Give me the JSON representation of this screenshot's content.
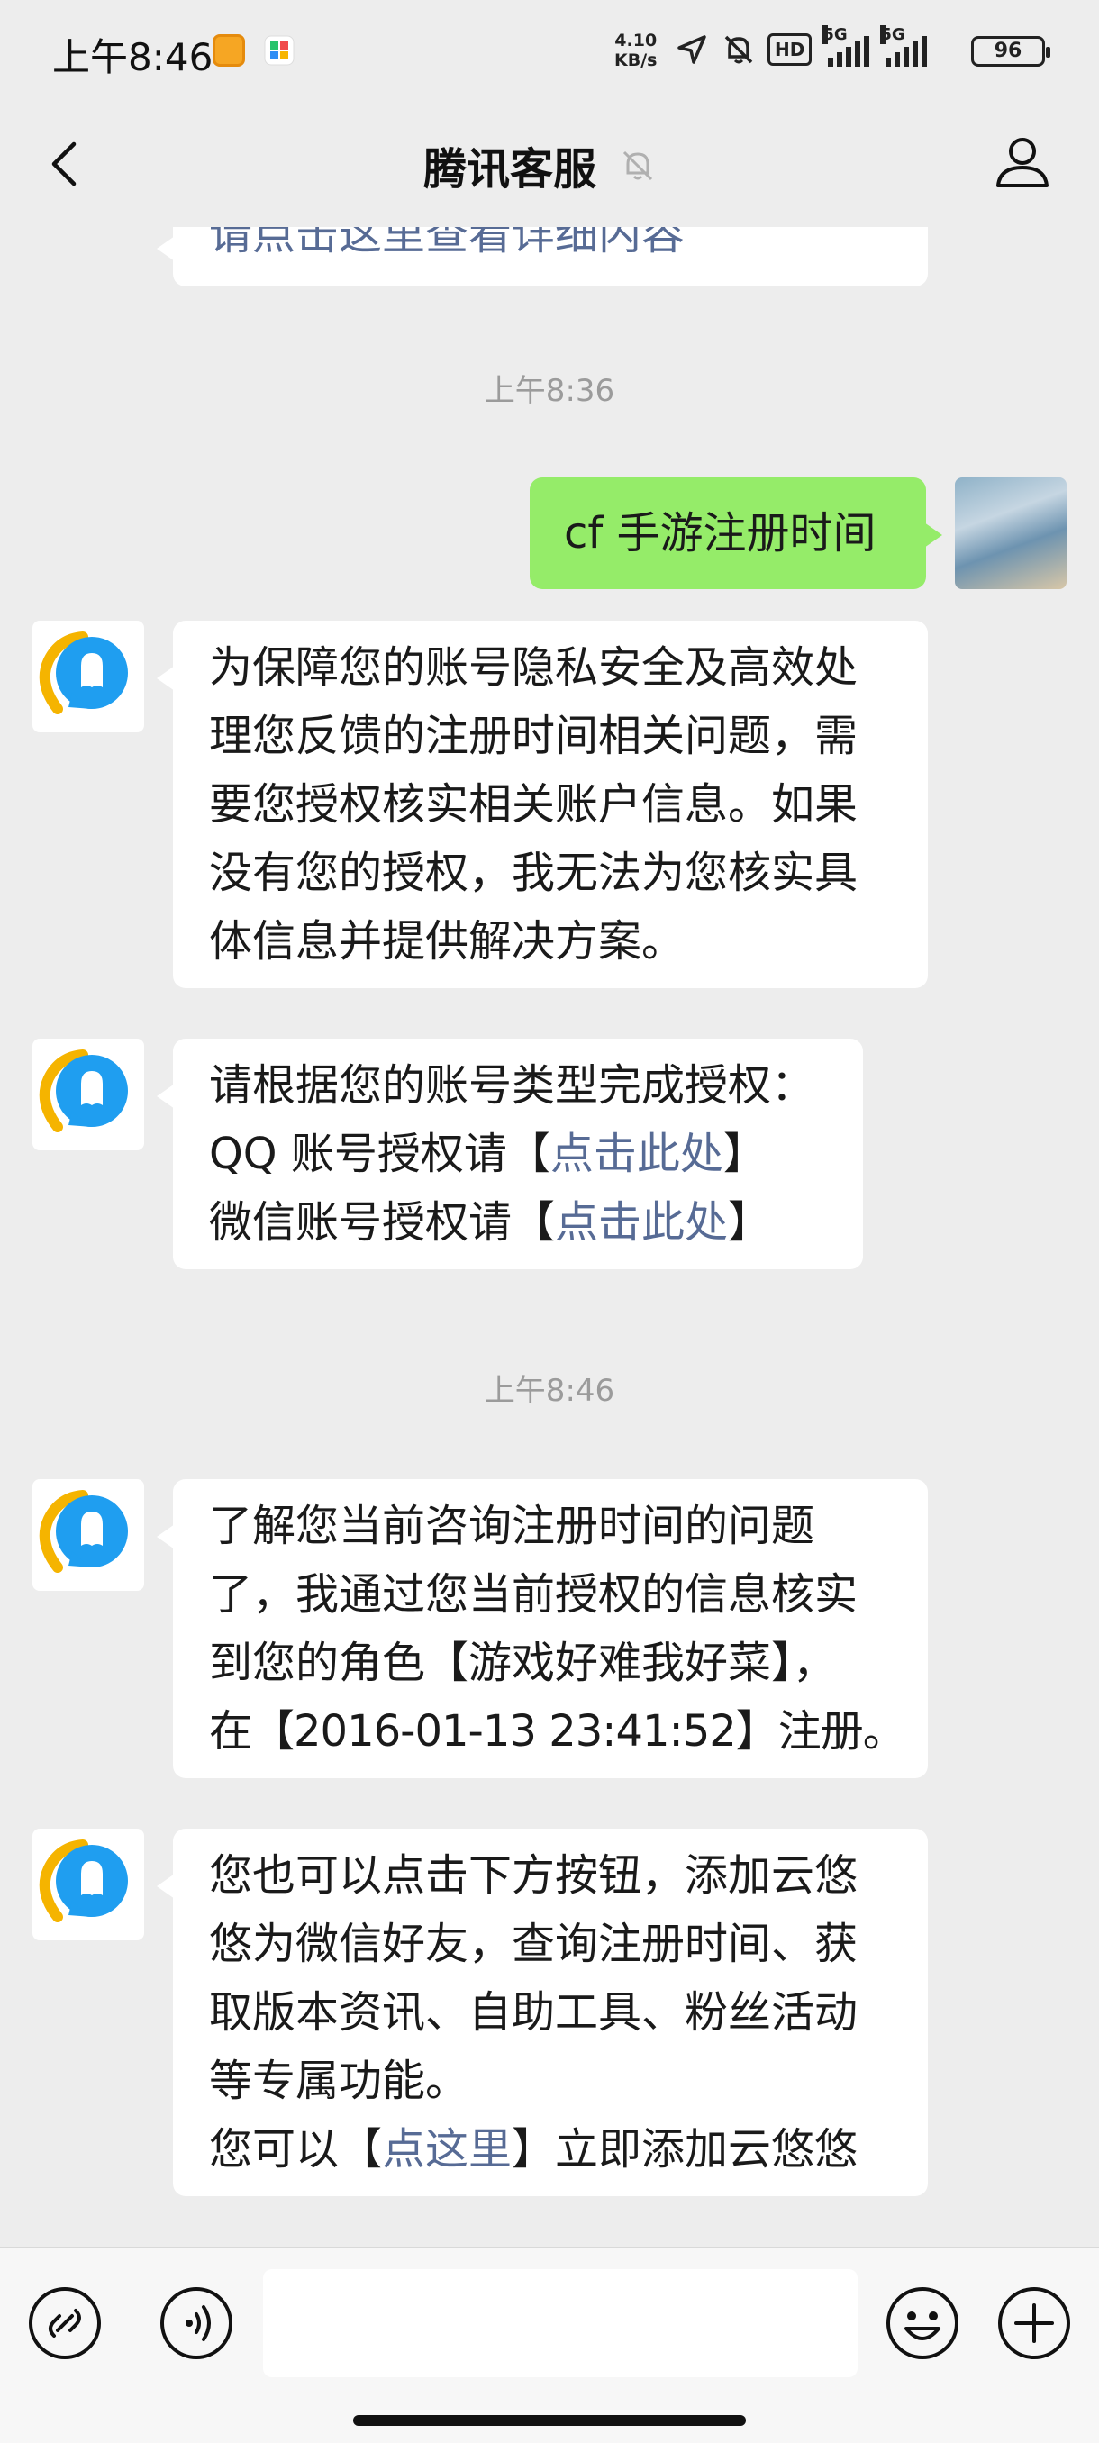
{
  "status_bar": {
    "time": "上午8:46",
    "net_speed_value": "4.10",
    "net_speed_unit": "KB/s",
    "hd_label": "HD",
    "sim1_label": "5G",
    "sim2_label": "5G",
    "battery": "96"
  },
  "header": {
    "title": "腾讯客服",
    "back_icon": "chevron-left-icon",
    "mute_icon": "bell-off-icon",
    "profile_icon": "person-icon"
  },
  "messages": {
    "partial_top": "请点击这里查看详细内容",
    "time_1": "上午8:36",
    "user_msg": "cf 手游注册时间",
    "m1_lines": [
      "为保障您的账号隐私安全及高效处",
      "理您反馈的注册时间相关问题，需",
      "要您授权核实相关账户信息。如果",
      "没有您的授权，我无法为您核实具",
      "体信息并提供解决方案。"
    ],
    "m2_line1": "请根据您的账号类型完成授权：",
    "m2_line2_prefix": "QQ 账号授权请【",
    "m2_line2_link": "点击此处",
    "m2_line2_suffix": "】",
    "m2_line3_prefix": "微信账号授权请【",
    "m2_line3_link": "点击此处",
    "m2_line3_suffix": "】",
    "time_2": "上午8:46",
    "m3_lines": [
      "了解您当前咨询注册时间的问题",
      "了，我通过您当前授权的信息核实",
      "到您的角色【游戏好难我好菜】，",
      "在【2016-01-13 23:41:52】注册。"
    ],
    "m4_lines": [
      "您也可以点击下方按钮，添加云悠",
      "悠为微信好友，查询注册时间、获",
      "取版本资讯、自助工具、粉丝活动",
      "等专属功能。"
    ],
    "m4_last_prefix": "您可以【",
    "m4_last_link": "点这里",
    "m4_last_suffix": "】立即添加云悠悠"
  },
  "input_bar": {
    "left_icon": "mini-program-icon",
    "voice_icon": "voice-icon",
    "emoji_icon": "emoji-icon",
    "plus_icon": "plus-icon",
    "placeholder": ""
  },
  "colors": {
    "background": "#ededed",
    "my_bubble": "#95ec69",
    "their_bubble": "#ffffff",
    "link": "#576b95",
    "timestamp": "#9b9b9b"
  }
}
